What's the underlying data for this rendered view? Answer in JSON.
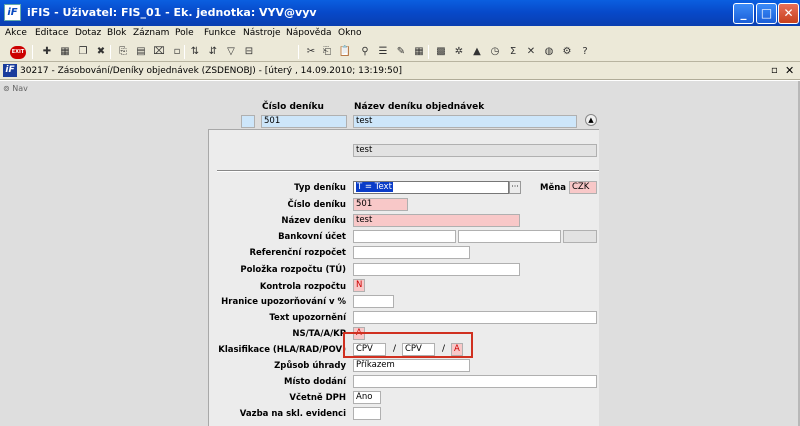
{
  "window": {
    "title": "iFIS - Uživatel: FIS_01 - Ek. jednotka: VYV@vyv",
    "app_icon": "iF",
    "minimize": "_",
    "maximize": "□",
    "close": "✕"
  },
  "menu": [
    "Akce",
    "Editace",
    "Dotaz",
    "Blok",
    "Záznam",
    "Pole",
    "Funkce",
    "Nástroje",
    "Nápověda",
    "Okno"
  ],
  "toolbar": {
    "exit_label": "EXIT"
  },
  "form": {
    "icon": "iF",
    "title": "30217 - Zásobování/Deníky objednávek (ZSDENOBJ) - [úterý , 14.09.2010; 13:19:50]",
    "restore": "▫",
    "close": "✕"
  },
  "nav": {
    "label": "Nav"
  },
  "header": {
    "col_number": "Číslo deníku",
    "col_name": "Název deníku objednávek",
    "row_number": "501",
    "row_name": "test",
    "detail_name": "test"
  },
  "fields": {
    "typ_label": "Typ deníku",
    "typ_value": "T = Text",
    "mena_label": "Měna",
    "mena_value": "CZK",
    "cislo_label": "Číslo deníku",
    "cislo_value": "501",
    "nazev_label": "Název deníku",
    "nazev_value": "test",
    "bankovni_label": "Bankovní účet",
    "referencni_label": "Referenční rozpočet",
    "polozka_label": "Položka rozpočtu (TÚ)",
    "kontrola_label": "Kontrola rozpočtu",
    "kontrola_value": "N",
    "hranice_label": "Hranice upozorňování v %",
    "text_label": "Text upozornění",
    "ns_label": "NS/TA/A/KP",
    "ns_value": "A",
    "klasifikace_label": "Klasifikace (HLA/RAD/POV)",
    "klas_1": "CPV",
    "klas_2": "CPV",
    "klas_3": "A",
    "klas_sep": "/",
    "zpusob_label": "Způsob úhrady",
    "zpusob_value": "Příkazem",
    "misto_label": "Místo dodání",
    "vcetne_label": "Včetně DPH",
    "vcetne_value": "Ano",
    "vazba_label": "Vazba na skl. evidenci"
  },
  "colors": {
    "titlebar": "#0748c8",
    "highlight_box": "#d03020",
    "required_field": "#f8c8c8",
    "key_field": "#cde6fa"
  }
}
